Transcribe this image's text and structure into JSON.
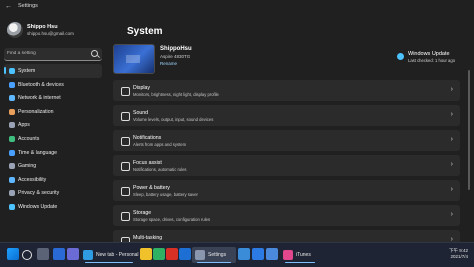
{
  "window": {
    "back_glyph": "←",
    "title": "Settings"
  },
  "profile": {
    "name": "Shippo Hsu",
    "email": "shippo.hsu@gmail.com"
  },
  "search": {
    "placeholder": "Find a setting"
  },
  "sidebar": {
    "items": [
      {
        "label": "System",
        "icon": "monitor-icon",
        "color": "#4cc2ff",
        "active": true
      },
      {
        "label": "Bluetooth & devices",
        "icon": "bluetooth-icon",
        "color": "#4aa0ff",
        "active": false
      },
      {
        "label": "Network & internet",
        "icon": "network-icon",
        "color": "#5fb8ff",
        "active": false
      },
      {
        "label": "Personalization",
        "icon": "brush-icon",
        "color": "#e8a05c",
        "active": false
      },
      {
        "label": "Apps",
        "icon": "apps-icon",
        "color": "#9aa3b5",
        "active": false
      },
      {
        "label": "Accounts",
        "icon": "person-icon",
        "color": "#3fbf7f",
        "active": false
      },
      {
        "label": "Time & language",
        "icon": "globe-icon",
        "color": "#4aa0ff",
        "active": false
      },
      {
        "label": "Gaming",
        "icon": "controller-icon",
        "color": "#9aa3b5",
        "active": false
      },
      {
        "label": "Accessibility",
        "icon": "accessibility-icon",
        "color": "#5fb8ff",
        "active": false
      },
      {
        "label": "Privacy & security",
        "icon": "shield-icon",
        "color": "#9aa3b5",
        "active": false
      },
      {
        "label": "Windows Update",
        "icon": "update-icon",
        "color": "#4cc2ff",
        "active": false
      }
    ]
  },
  "main": {
    "title": "System",
    "device": {
      "name": "ShippoHsu",
      "model": "Aspire 4830TG",
      "rename": "Rename"
    },
    "update": {
      "title": "Windows Update",
      "subtitle": "Last checked: 1 hour ago"
    },
    "cards": [
      {
        "title": "Display",
        "subtitle": "Monitors, brightness, night light, display profile",
        "icon": "display-icon"
      },
      {
        "title": "Sound",
        "subtitle": "Volume levels, output, input, sound devices",
        "icon": "speaker-icon"
      },
      {
        "title": "Notifications",
        "subtitle": "Alerts from apps and system",
        "icon": "bell-icon"
      },
      {
        "title": "Focus assist",
        "subtitle": "Notifications, automatic rules",
        "icon": "moon-icon"
      },
      {
        "title": "Power & battery",
        "subtitle": "Sleep, battery usage, battery saver",
        "icon": "power-icon"
      },
      {
        "title": "Storage",
        "subtitle": "Storage space, drives, configuration rules",
        "icon": "storage-icon"
      },
      {
        "title": "Multi-tasking",
        "subtitle": "Snap windows, desktops, task switching",
        "icon": "multitask-icon"
      }
    ],
    "chevron": "›"
  },
  "taskbar": {
    "tasks": [
      {
        "label": "New tab - Personal -",
        "icon": "browser-icon",
        "color": "#2f9be0"
      },
      {
        "label": "Settings",
        "icon": "settings-icon",
        "color": "#8a96ad"
      },
      {
        "label": "iTunes",
        "icon": "itunes-icon",
        "color": "#e0478c"
      }
    ],
    "tray_line1": "下午 9:42",
    "tray_line2": "2021/7/4"
  }
}
